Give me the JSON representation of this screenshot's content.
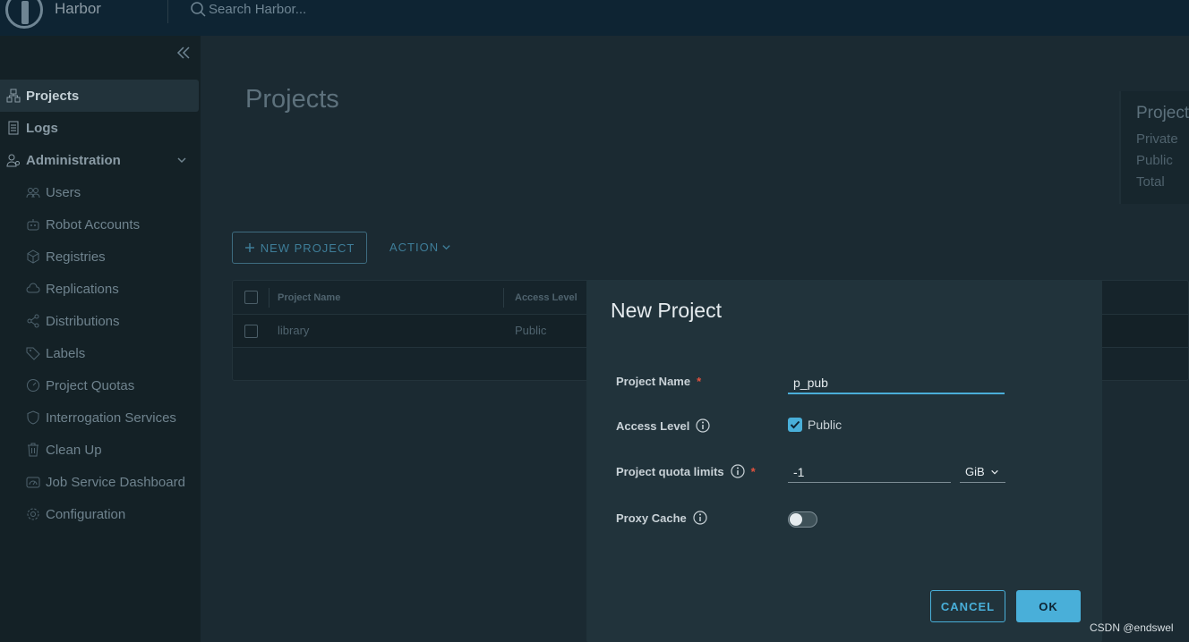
{
  "header": {
    "brand": "Harbor",
    "search_placeholder": "Search Harbor..."
  },
  "sidebar": {
    "items": [
      {
        "label": "Projects",
        "icon": "projects-icon"
      },
      {
        "label": "Logs",
        "icon": "logs-icon"
      },
      {
        "label": "Administration",
        "icon": "administration-icon"
      },
      {
        "label": "Users",
        "icon": "users-icon"
      },
      {
        "label": "Robot Accounts",
        "icon": "robot-icon"
      },
      {
        "label": "Registries",
        "icon": "registries-icon"
      },
      {
        "label": "Replications",
        "icon": "replications-icon"
      },
      {
        "label": "Distributions",
        "icon": "distributions-icon"
      },
      {
        "label": "Labels",
        "icon": "labels-icon"
      },
      {
        "label": "Project Quotas",
        "icon": "quotas-icon"
      },
      {
        "label": "Interrogation Services",
        "icon": "shield-icon"
      },
      {
        "label": "Clean Up",
        "icon": "trash-icon"
      },
      {
        "label": "Job Service Dashboard",
        "icon": "dashboard-icon"
      },
      {
        "label": "Configuration",
        "icon": "gear-icon"
      }
    ]
  },
  "main": {
    "title": "Projects",
    "summary": {
      "title": "Project",
      "rows": [
        "Private",
        "Public",
        "Total"
      ]
    },
    "new_project_label": "NEW PROJECT",
    "action_label": "ACTION",
    "table": {
      "columns": [
        "Project Name",
        "Access Level"
      ],
      "rows": [
        {
          "name": "library",
          "access": "Public"
        }
      ]
    }
  },
  "modal": {
    "title": "New Project",
    "project_name_label": "Project Name",
    "project_name_value": "p_pub",
    "access_level_label": "Access Level",
    "access_public_label": "Public",
    "access_public_checked": true,
    "quota_label": "Project quota limits",
    "quota_value": "-1",
    "quota_unit": "GiB",
    "proxy_cache_label": "Proxy Cache",
    "proxy_cache_enabled": false,
    "required_mark": "*",
    "cancel_label": "CANCEL",
    "ok_label": "OK"
  },
  "watermark": "CSDN @endswel",
  "colors": {
    "accent": "#49afd9",
    "header_bg": "#0e2433",
    "required": "#e2523e"
  }
}
